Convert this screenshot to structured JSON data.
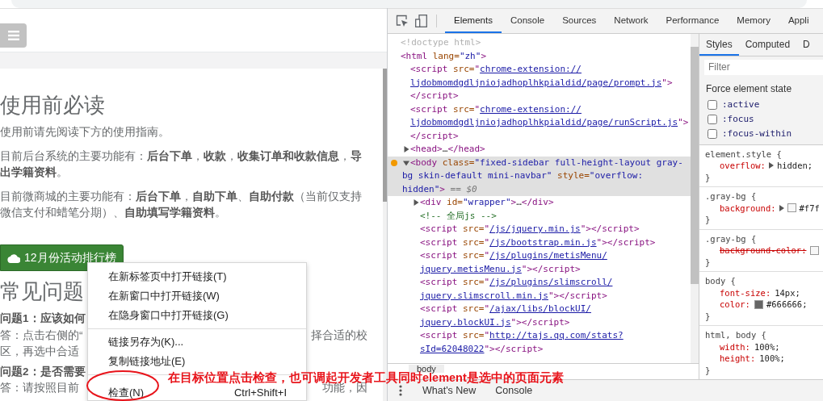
{
  "page": {
    "heading": "使用前必读",
    "intro": "使用前请先阅读下方的使用指南。",
    "paragraphs": [
      "目前后台系统的主要功能有：**后台下单**，**收款**，**收集订单和收款信息**，**导出学籍资料**。",
      "目前微商城的主要功能有：**后台下单**，**自助下单**、**自助付款**（当前仅支持微信支付和蜡笔分期）、**自助填写学籍资料**。"
    ],
    "ranking_button": {
      "label": "12月份活动排行榜"
    },
    "faq_heading": "常见问题",
    "faq_rows": [
      {
        "kind": "question",
        "left": "问题1：应该如何"
      },
      {
        "kind": "answer",
        "left": "答：点击右侧的“",
        "right": "择合适的校"
      },
      {
        "kind": "answer",
        "left": "区，再选中合适"
      },
      {
        "kind": "question",
        "left": "问题2：是否需要"
      },
      {
        "kind": "answer",
        "left": "答：请按照目前",
        "right": "功能，因"
      }
    ]
  },
  "context_menu": {
    "items": [
      {
        "kind": "item",
        "label": "在新标签页中打开链接(T)"
      },
      {
        "kind": "item",
        "label": "在新窗口中打开链接(W)"
      },
      {
        "kind": "item",
        "label": "在隐身窗口中打开链接(G)"
      },
      {
        "kind": "separator"
      },
      {
        "kind": "item",
        "label": "链接另存为(K)..."
      },
      {
        "kind": "item",
        "label": "复制链接地址(E)"
      },
      {
        "kind": "separator"
      },
      {
        "kind": "item",
        "label": "检查(N)",
        "shortcut": "Ctrl+Shift+I"
      }
    ]
  },
  "annotation": {
    "text": "在目标位置点击检查，也可调起开发者工具同时element是选中的页面元素"
  },
  "devtools": {
    "tabs": [
      {
        "label": "Elements",
        "selected": true
      },
      {
        "label": "Console",
        "selected": false
      },
      {
        "label": "Sources",
        "selected": false
      },
      {
        "label": "Network",
        "selected": false
      },
      {
        "label": "Performance",
        "selected": false
      },
      {
        "label": "Memory",
        "selected": false
      },
      {
        "label": "Appli",
        "selected": false
      }
    ],
    "nodes": [
      {
        "selected": false,
        "lines": [
          [
            {
              "kind": "doc",
              "text": "<!doctype html>"
            }
          ]
        ]
      },
      {
        "selected": false,
        "lines": [
          [
            {
              "kind": "tag",
              "text": "<html"
            },
            {
              "kind": "attr",
              "text": " lang="
            },
            {
              "kind": "val",
              "text": "\"zh\""
            },
            {
              "kind": "tag",
              "text": ">"
            }
          ]
        ],
        "children": [
          {
            "selected": false,
            "lines": [
              [
                {
                  "kind": "tag",
                  "text": "<script"
                },
                {
                  "kind": "attr",
                  "text": " src="
                },
                {
                  "kind": "tag",
                  "text": "\""
                },
                {
                  "kind": "link",
                  "text": "chrome-extension://"
                }
              ],
              [
                {
                  "kind": "link",
                  "text": "ljdobmomdgdljniojadhoplhkpialdid/page/prompt.js"
                },
                {
                  "kind": "tag",
                  "text": "\">"
                }
              ],
              [
                {
                  "kind": "tag",
                  "text": "</script>"
                }
              ]
            ]
          },
          {
            "selected": false,
            "lines": [
              [
                {
                  "kind": "tag",
                  "text": "<script"
                },
                {
                  "kind": "attr",
                  "text": " src="
                },
                {
                  "kind": "tag",
                  "text": "\""
                },
                {
                  "kind": "link",
                  "text": "chrome-extension://"
                }
              ],
              [
                {
                  "kind": "link",
                  "text": "ljdobmomdgdljniojadhoplhkpialdid/page/runScript.js"
                },
                {
                  "kind": "tag",
                  "text": "\">"
                }
              ],
              [
                {
                  "kind": "tag",
                  "text": "</script>"
                }
              ]
            ]
          },
          {
            "selected": false,
            "expanded": false,
            "lines": [
              [
                {
                  "kind": "tag",
                  "text": "<head>"
                },
                {
                  "kind": "plain",
                  "text": "…"
                },
                {
                  "kind": "tag",
                  "text": "</head>"
                }
              ]
            ]
          },
          {
            "selected": true,
            "expanded": true,
            "breakpoint": true,
            "lines": [
              [
                {
                  "kind": "tag",
                  "text": "<body"
                },
                {
                  "kind": "attr",
                  "text": " class="
                },
                {
                  "kind": "val",
                  "text": "\"fixed-sidebar full-height-layout gray-"
                }
              ],
              [
                {
                  "kind": "val",
                  "text": "bg skin-default mini-navbar\""
                },
                {
                  "kind": "attr",
                  "text": " style="
                },
                {
                  "kind": "val",
                  "text": "\"overflow:"
                }
              ],
              [
                {
                  "kind": "val",
                  "text": "hidden\""
                },
                {
                  "kind": "tag",
                  "text": ">"
                },
                {
                  "kind": "eq",
                  "text": " == $0"
                }
              ]
            ],
            "children": [
              {
                "selected": false,
                "expanded": false,
                "lines": [
                  [
                    {
                      "kind": "tag",
                      "text": "<div"
                    },
                    {
                      "kind": "attr",
                      "text": " id="
                    },
                    {
                      "kind": "val",
                      "text": "\"wrapper\""
                    },
                    {
                      "kind": "tag",
                      "text": ">"
                    },
                    {
                      "kind": "plain",
                      "text": "…"
                    },
                    {
                      "kind": "tag",
                      "text": "</div>"
                    }
                  ]
                ]
              },
              {
                "selected": false,
                "lines": [
                  [
                    {
                      "kind": "comment",
                      "text": "<!-- 全局js -->"
                    }
                  ]
                ]
              },
              {
                "selected": false,
                "lines": [
                  [
                    {
                      "kind": "tag",
                      "text": "<script"
                    },
                    {
                      "kind": "attr",
                      "text": " src="
                    },
                    {
                      "kind": "tag",
                      "text": "\""
                    },
                    {
                      "kind": "link",
                      "text": "/js/jquery.min.js"
                    },
                    {
                      "kind": "tag",
                      "text": "\"></script>"
                    }
                  ]
                ]
              },
              {
                "selected": false,
                "lines": [
                  [
                    {
                      "kind": "tag",
                      "text": "<script"
                    },
                    {
                      "kind": "attr",
                      "text": " src="
                    },
                    {
                      "kind": "tag",
                      "text": "\""
                    },
                    {
                      "kind": "link",
                      "text": "/js/bootstrap.min.js"
                    },
                    {
                      "kind": "tag",
                      "text": "\"></script>"
                    }
                  ]
                ]
              },
              {
                "selected": false,
                "lines": [
                  [
                    {
                      "kind": "tag",
                      "text": "<script"
                    },
                    {
                      "kind": "attr",
                      "text": " src="
                    },
                    {
                      "kind": "tag",
                      "text": "\""
                    },
                    {
                      "kind": "link",
                      "text": "/js/plugins/metisMenu/"
                    }
                  ],
                  [
                    {
                      "kind": "link",
                      "text": "jquery.metisMenu.js"
                    },
                    {
                      "kind": "tag",
                      "text": "\"></script>"
                    }
                  ]
                ]
              },
              {
                "selected": false,
                "lines": [
                  [
                    {
                      "kind": "tag",
                      "text": "<script"
                    },
                    {
                      "kind": "attr",
                      "text": " src="
                    },
                    {
                      "kind": "tag",
                      "text": "\""
                    },
                    {
                      "kind": "link",
                      "text": "/js/plugins/slimscroll/"
                    }
                  ],
                  [
                    {
                      "kind": "link",
                      "text": "jquery.slimscroll.min.js"
                    },
                    {
                      "kind": "tag",
                      "text": "\"></script>"
                    }
                  ]
                ]
              },
              {
                "selected": false,
                "lines": [
                  [
                    {
                      "kind": "tag",
                      "text": "<script"
                    },
                    {
                      "kind": "attr",
                      "text": " src="
                    },
                    {
                      "kind": "tag",
                      "text": "\""
                    },
                    {
                      "kind": "link",
                      "text": "/ajax/libs/blockUI/"
                    }
                  ],
                  [
                    {
                      "kind": "link",
                      "text": "jquery.blockUI.js"
                    },
                    {
                      "kind": "tag",
                      "text": "\"></script>"
                    }
                  ]
                ]
              },
              {
                "selected": false,
                "lines": [
                  [
                    {
                      "kind": "tag",
                      "text": "<script"
                    },
                    {
                      "kind": "attr",
                      "text": " src="
                    },
                    {
                      "kind": "tag",
                      "text": "\""
                    },
                    {
                      "kind": "link",
                      "text": "http://tajs.qq.com/stats?"
                    }
                  ],
                  [
                    {
                      "kind": "link",
                      "text": "sId=62048022"
                    },
                    {
                      "kind": "tag",
                      "text": "\"></script>"
                    }
                  ]
                ]
              }
            ]
          }
        ]
      }
    ],
    "breadcrumb": "body",
    "styles_tabs": [
      {
        "label": "Styles",
        "selected": true
      },
      {
        "label": "Computed",
        "selected": false
      },
      {
        "label": "D",
        "selected": false
      }
    ],
    "filter": {
      "placeholder": "Filter"
    },
    "force_state": {
      "title": "Force element state",
      "options": [
        {
          "label": ":active",
          "checked": false
        },
        {
          "label": ":focus",
          "checked": false
        },
        {
          "label": ":focus-within",
          "checked": false
        }
      ]
    },
    "rules": [
      {
        "selector": "element.style {",
        "close": "}",
        "props": [
          {
            "name": "overflow:",
            "expandable": true,
            "value": "hidden;",
            "overridden": false
          }
        ]
      },
      {
        "selector": ".gray-bg {",
        "close": "}",
        "props": [
          {
            "name": "background:",
            "expandable": true,
            "color": "#f7f7f7",
            "value": "#f7f",
            "overridden": false
          }
        ]
      },
      {
        "selector": ".gray-bg {",
        "close": "}",
        "props": [
          {
            "name": "background-color:",
            "color": "#f7f7f7",
            "overridden": true
          }
        ]
      },
      {
        "selector": "body {",
        "close": "}",
        "props": [
          {
            "name": "font-size:",
            "value": "14px;",
            "overridden": false
          },
          {
            "name": "color:",
            "color": "#666666",
            "value": "#666666;",
            "overridden": false
          }
        ]
      },
      {
        "selector": "html, body {",
        "close": "}",
        "props": [
          {
            "name": "width:",
            "value": "100%;",
            "overridden": false
          },
          {
            "name": "height:",
            "value": "100%;",
            "overridden": false
          }
        ]
      }
    ],
    "drawer_tabs": [
      "What's New",
      "Console"
    ]
  }
}
